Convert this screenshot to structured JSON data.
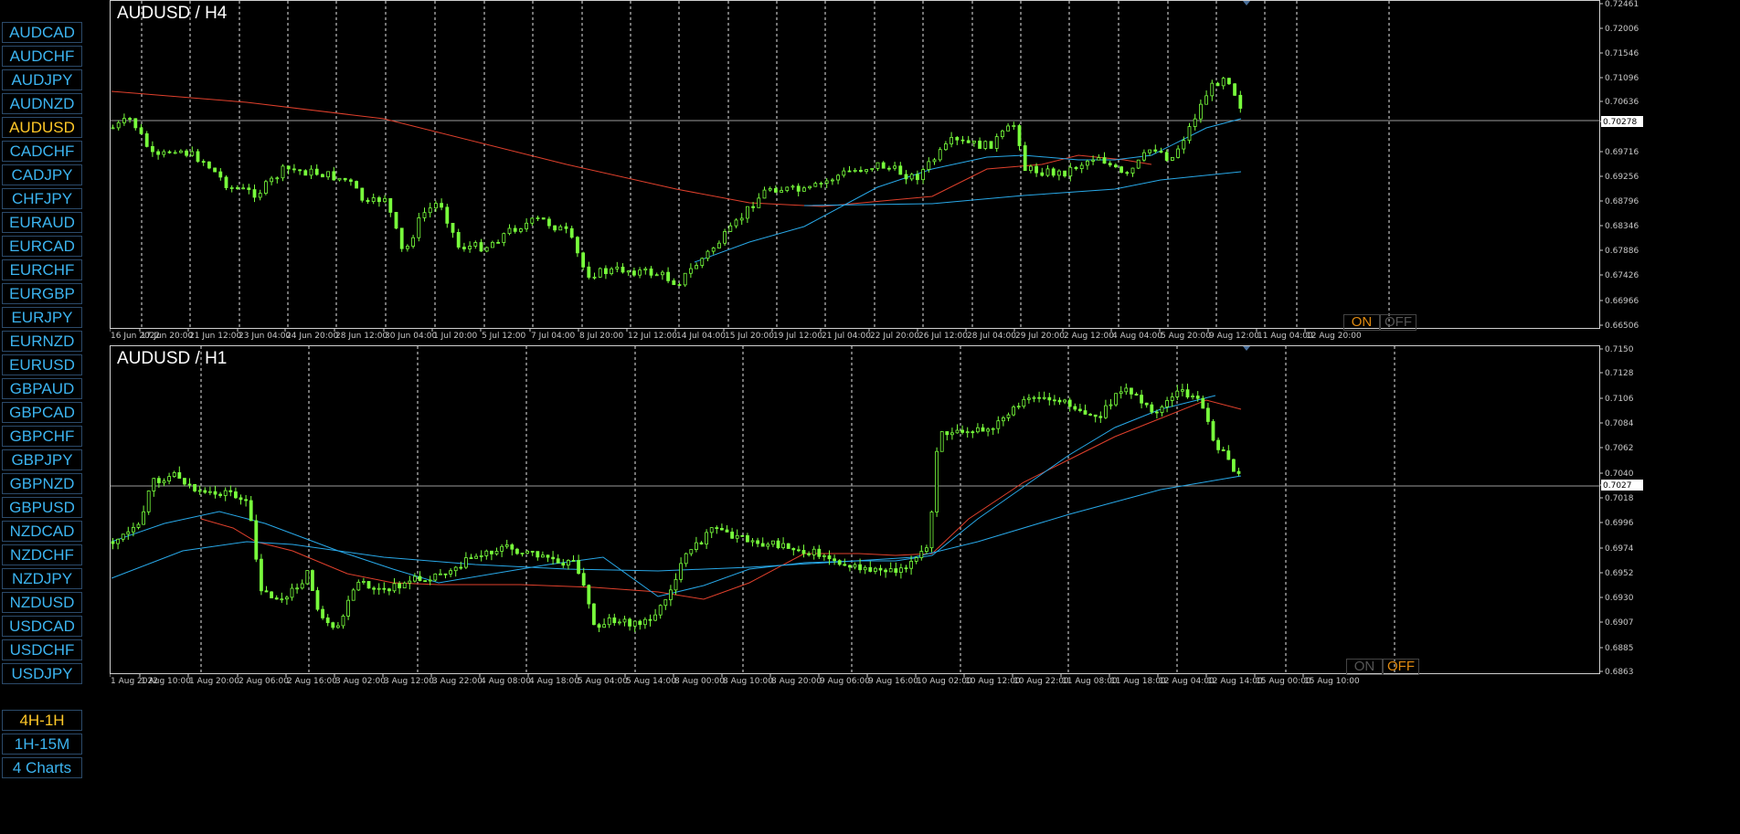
{
  "sidebar": {
    "symbols": [
      "AUDCAD",
      "AUDCHF",
      "AUDJPY",
      "AUDNZD",
      "AUDUSD",
      "CADCHF",
      "CADJPY",
      "CHFJPY",
      "EURAUD",
      "EURCAD",
      "EURCHF",
      "EURGBP",
      "EURJPY",
      "EURNZD",
      "EURUSD",
      "GBPAUD",
      "GBPCAD",
      "GBPCHF",
      "GBPJPY",
      "GBPNZD",
      "GBPUSD",
      "NZDCAD",
      "NZDCHF",
      "NZDJPY",
      "NZDUSD",
      "USDCAD",
      "USDCHF",
      "USDJPY"
    ],
    "active_symbol": "AUDUSD",
    "modes": [
      "4H-1H",
      "1H-15M",
      "4 Charts"
    ],
    "active_mode": "4H-1H"
  },
  "colors": {
    "candle": "#78ff3c",
    "ma_fast": "#28a8e8",
    "ma_slow": "#e0402c",
    "grid": "#e6e6e6",
    "active": "#ffc828",
    "inactive": "#3cb4f0"
  },
  "charts": [
    {
      "title": "AUDUSD / H4",
      "on_label": "ON",
      "off_label": "OFF",
      "toggle_state": "ON",
      "current_price": "0.70278",
      "y_ticks": [
        "0.72461",
        "0.72006",
        "0.71546",
        "0.71096",
        "0.70636",
        "0.70278",
        "0.69716",
        "0.69256",
        "0.68796",
        "0.68346",
        "0.67886",
        "0.67426",
        "0.66966",
        "0.66506"
      ],
      "x_ticks": [
        "16 Jun 2022",
        "17 Jun 20:00",
        "21 Jun 12:00",
        "23 Jun 04:00",
        "24 Jun 20:00",
        "28 Jun 12:00",
        "30 Jun 04:00",
        "1 Jul 20:00",
        "5 Jul 12:00",
        "7 Jul 04:00",
        "8 Jul 20:00",
        "12 Jul 12:00",
        "14 Jul 04:00",
        "15 Jul 20:00",
        "19 Jul 12:00",
        "21 Jul 04:00",
        "22 Jul 20:00",
        "26 Jul 12:00",
        "28 Jul 04:00",
        "29 Jul 20:00",
        "2 Aug 12:00",
        "4 Aug 04:00",
        "5 Aug 20:00",
        "9 Aug 12:00",
        "11 Aug 04:00",
        "12 Aug 20:00"
      ]
    },
    {
      "title": "AUDUSD / H1",
      "on_label": "ON",
      "off_label": "OFF",
      "toggle_state": "OFF",
      "current_price": "0.7027",
      "y_ticks": [
        "0.7150",
        "0.7128",
        "0.7106",
        "0.7084",
        "0.7062",
        "0.7040",
        "0.7027",
        "0.7018",
        "0.6996",
        "0.6974",
        "0.6952",
        "0.6930",
        "0.6907",
        "0.6885",
        "0.6863"
      ],
      "x_ticks": [
        "1 Aug 2022",
        "1 Aug 10:00",
        "1 Aug 20:00",
        "2 Aug 06:00",
        "2 Aug 16:00",
        "3 Aug 02:00",
        "3 Aug 12:00",
        "3 Aug 22:00",
        "4 Aug 08:00",
        "4 Aug 18:00",
        "5 Aug 04:00",
        "5 Aug 14:00",
        "8 Aug 00:00",
        "8 Aug 10:00",
        "8 Aug 20:00",
        "9 Aug 06:00",
        "9 Aug 16:00",
        "10 Aug 02:00",
        "10 Aug 12:00",
        "10 Aug 22:00",
        "11 Aug 08:00",
        "11 Aug 18:00",
        "12 Aug 04:00",
        "12 Aug 14:00",
        "15 Aug 00:00",
        "15 Aug 10:00"
      ]
    }
  ]
}
